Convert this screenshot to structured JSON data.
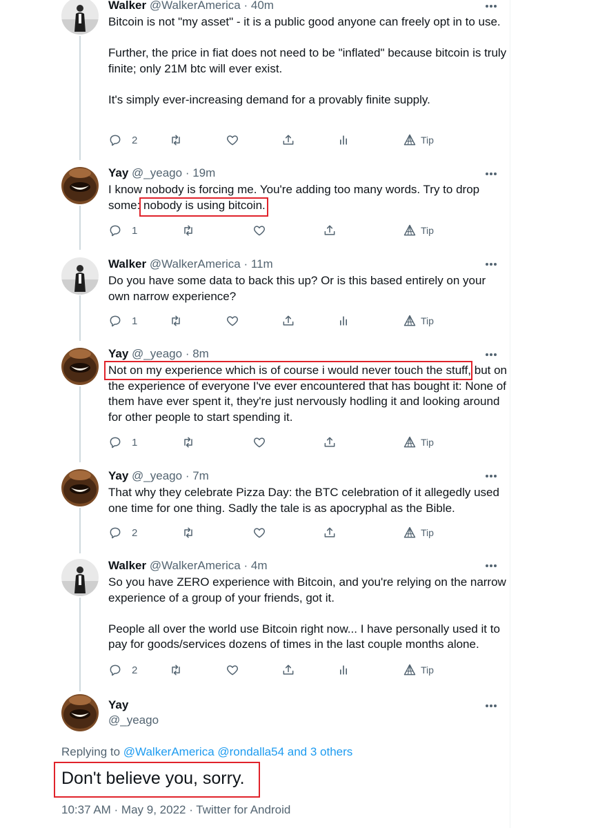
{
  "colors": {
    "text": "#0f1419",
    "secondary": "#536471",
    "link": "#1d9bf0",
    "highlight_box": "#e0222a",
    "thread_line": "#cfd9de"
  },
  "icons": [
    "reply-icon",
    "retweet-icon",
    "like-icon",
    "share-icon",
    "analytics-icon",
    "tip-icon",
    "more-icon"
  ],
  "tweets": [
    {
      "name": "Walker",
      "handle": "@WalkerAmerica",
      "sep": "·",
      "time": "40m",
      "paragraphs": [
        "Bitcoin is not \"my asset\" - it is a public good anyone can freely opt in to use.",
        "Further, the price in fiat does not need to be \"inflated\" because bitcoin is truly finite; only 21M btc will ever exist.",
        "It's simply ever-increasing demand for a provably finite supply."
      ],
      "replies": "2",
      "tip": "Tip"
    },
    {
      "name": "Yay",
      "handle": "@_yeago",
      "sep": "·",
      "time": "19m",
      "text_pre": "I know nobody is forcing me. You're adding too many words. Try to drop some: ",
      "text_highlight": "nobody is using bitcoin.",
      "replies": "1",
      "tip": "Tip"
    },
    {
      "name": "Walker",
      "handle": "@WalkerAmerica",
      "sep": "·",
      "time": "11m",
      "text": "Do you have some data to back this up? Or is this based entirely on your own narrow experience?",
      "replies": "1",
      "tip": "Tip"
    },
    {
      "name": "Yay",
      "handle": "@_yeago",
      "sep": "·",
      "time": "8m",
      "text_highlight": "Not on my experience which is of course i would never touch the stuff,",
      "text_post": " but on the experience of everyone I've ever encountered that has bought it: None of them have ever spent it, they're just nervously hodling it and looking around for other people to start spending it.",
      "replies": "1",
      "tip": "Tip"
    },
    {
      "name": "Yay",
      "handle": "@_yeago",
      "sep": "·",
      "time": "7m",
      "text": "That why they celebrate Pizza Day: the BTC celebration of it allegedly used one time for one thing. Sadly the tale is as apocryphal as the Bible.",
      "replies": "2",
      "tip": "Tip"
    },
    {
      "name": "Walker",
      "handle": "@WalkerAmerica",
      "sep": "·",
      "time": "4m",
      "paragraphs": [
        "So you have ZERO experience with Bitcoin, and you're relying on the narrow experience of a group of your friends, got it.",
        "People all over the world use Bitcoin right now... I have personally used it to pay for goods/services dozens of times in the last couple months alone."
      ],
      "replies": "2",
      "tip": "Tip"
    }
  ],
  "main_tweet": {
    "name": "Yay",
    "handle": "@_yeago",
    "replying_prefix": "Replying to",
    "replying_links": "@WalkerAmerica @rondalla54 and 3 others",
    "text": "Don't believe you, sorry.",
    "meta": "10:37 AM · May 9, 2022 · Twitter for Android"
  }
}
